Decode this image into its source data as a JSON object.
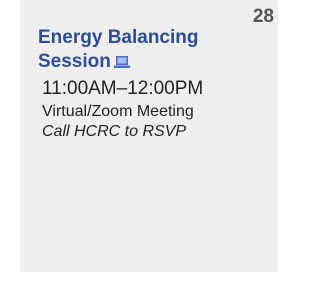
{
  "calendar_cell": {
    "day": "28",
    "event": {
      "title": "Energy Balancing Session",
      "icon": "laptop-icon",
      "time": "11:00AM–12:00PM",
      "location": "Virtual/Zoom Meeting",
      "note": "Call HCRC to RSVP"
    }
  },
  "colors": {
    "cell_background": "#efefef",
    "title": "#2e4c97",
    "icon": "#4a6fc7",
    "day_number": "#555555",
    "text": "#222222"
  }
}
